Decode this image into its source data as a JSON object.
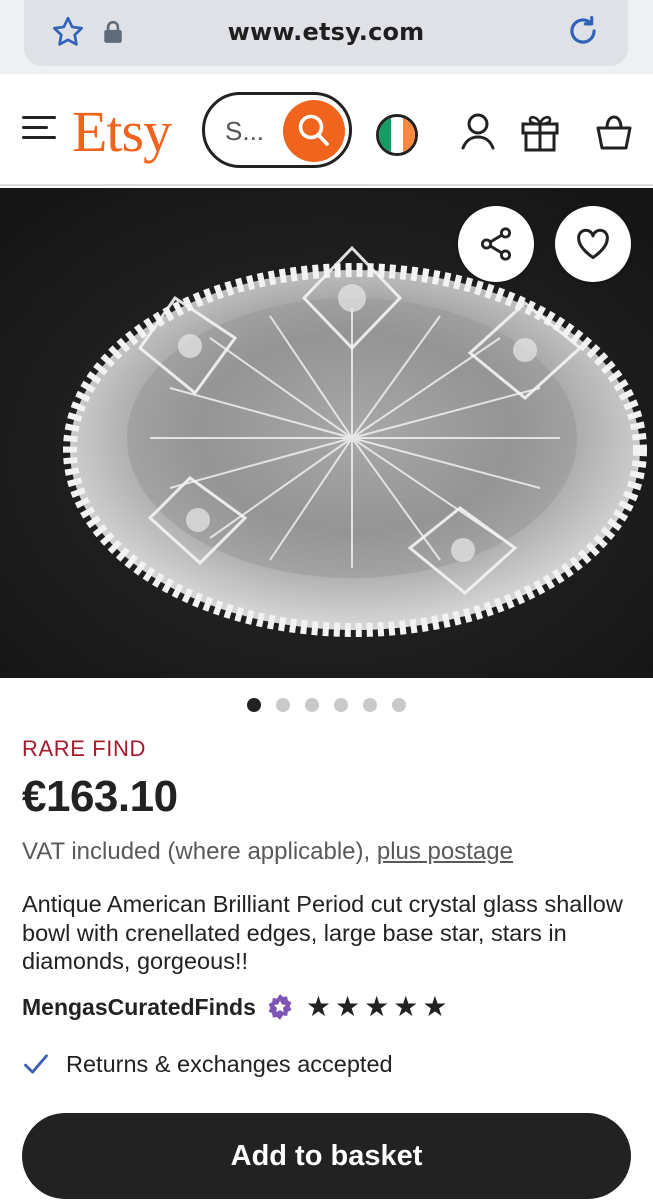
{
  "browser": {
    "url": "www.etsy.com",
    "icons": [
      "star-icon",
      "lock-icon",
      "reload-icon"
    ]
  },
  "header": {
    "logo": "Etsy",
    "search_value": "S...",
    "icons": [
      "menu-icon",
      "search-icon",
      "ireland-flag-icon",
      "account-icon",
      "gift-icon",
      "basket-icon"
    ],
    "accent_color": "#f1641e"
  },
  "image": {
    "buttons": [
      "share-icon",
      "heart-icon"
    ],
    "slides_total": 6,
    "active_slide": 1
  },
  "product": {
    "badge": "RARE FIND",
    "price": "€163.10",
    "vat_text": "VAT included (where applicable),",
    "postage_link": "plus postage",
    "title": "Antique American Brilliant Period cut crystal glass shallow bowl with crenellated edges, large base star, stars in diamonds, gorgeous!!",
    "shop_name": "MengasCuratedFinds",
    "rating_stars": 5,
    "returns_text": "Returns & exchanges accepted",
    "badge_color": "#a61a2e"
  },
  "actions": {
    "add_to_basket": "Add to basket"
  }
}
